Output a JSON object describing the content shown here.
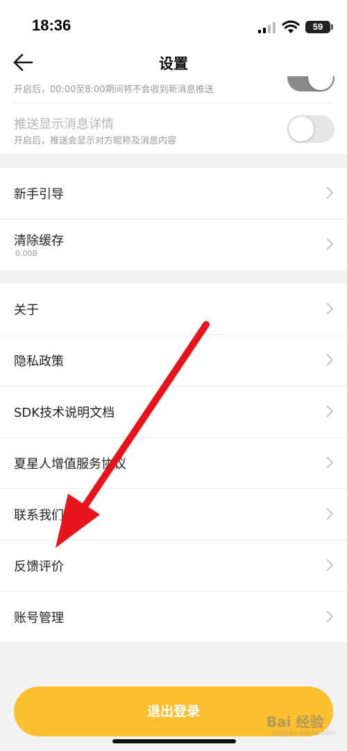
{
  "status_bar": {
    "time": "18:36",
    "battery": "59"
  },
  "nav": {
    "title": "设置",
    "back_icon": "back-arrow-icon"
  },
  "notifications": {
    "dnd_description": "开启后，00:00至8:00期间将不会收到新消息推送",
    "dnd_enabled": true,
    "push_detail_title": "推送显示消息详情",
    "push_detail_description": "开启后，推送会显示对方昵称及消息内容",
    "push_detail_enabled": false
  },
  "group1": {
    "items": [
      {
        "label": "新手引导"
      },
      {
        "label": "清除缓存",
        "sub": "0.00B"
      }
    ]
  },
  "group2": {
    "items": [
      {
        "label": "关于"
      },
      {
        "label": "隐私政策"
      },
      {
        "label": "SDK技术说明文档"
      },
      {
        "label": "夏星人增值服务协议"
      },
      {
        "label": "联系我们"
      },
      {
        "label": "反馈评价"
      },
      {
        "label": "账号管理"
      }
    ]
  },
  "logout_label": "退出登录",
  "colors": {
    "accent": "#fbbf2f",
    "arrow": "#e8141b",
    "toggle_on": "#8a8a8a",
    "toggle_off": "#e6e6e6"
  },
  "watermark": {
    "text": "Bai 经验",
    "sub": "jingyan.baidu.com"
  }
}
